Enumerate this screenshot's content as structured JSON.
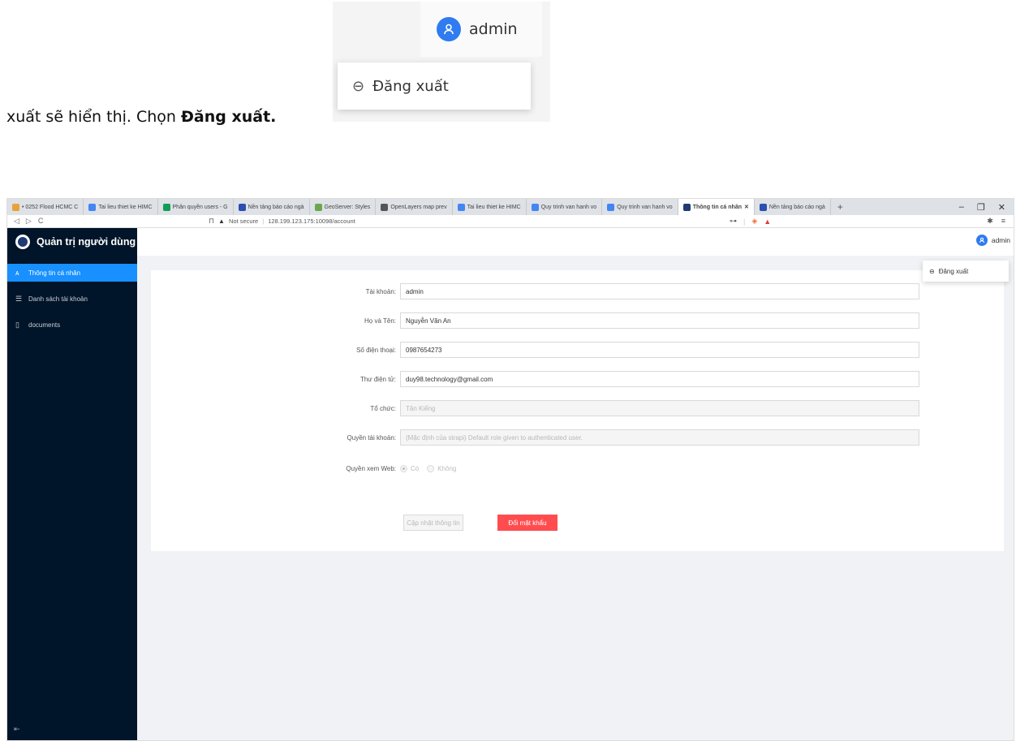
{
  "doc": {
    "text_prefix": "xuất sẽ hiển thị. Chọn ",
    "text_bold": "Đăng xuất."
  },
  "inset": {
    "username": "admin",
    "logout_label": "Đăng xuất",
    "logout_icon": "logout-icon"
  },
  "browser": {
    "tabs": [
      {
        "label": "• 0252 Flood HCMC C",
        "color": "#e8a23a"
      },
      {
        "label": "Tai lieu thiet ke HIMC",
        "color": "#4285f4"
      },
      {
        "label": "Phân quyền users - G",
        "color": "#0f9d58"
      },
      {
        "label": "Nền tảng báo cáo ngà",
        "color": "#2a4fb0"
      },
      {
        "label": "GeoServer: Styles",
        "color": "#6aa84f"
      },
      {
        "label": "OpenLayers map prev",
        "color": "#555555"
      },
      {
        "label": "Tai lieu thiet ke HIMC",
        "color": "#4285f4"
      },
      {
        "label": "Quy trinh van hanh vo",
        "color": "#4285f4"
      },
      {
        "label": "Quy trinh van hanh vo",
        "color": "#4285f4"
      },
      {
        "label": "Thông tin cá nhân",
        "color": "#1f3b73",
        "active": true
      },
      {
        "label": "Nền tảng báo cáo ngà",
        "color": "#2a4fb0"
      }
    ],
    "security": "Not secure",
    "url": "128.199.123.175:10098/account"
  },
  "app": {
    "title": "Quản trị người dùng",
    "menu": [
      {
        "label": "Thông tin cá nhân",
        "icon": "user-icon"
      },
      {
        "label": "Danh sách tài khoản",
        "icon": "list-icon"
      },
      {
        "label": "documents",
        "icon": "file-icon"
      }
    ],
    "header_user": "admin",
    "dropdown_logout": "Đăng xuất"
  },
  "form": {
    "account_label": "Tài khoản:",
    "account_value": "admin",
    "name_label": "Họ và Tên:",
    "name_value": "Nguyễn Văn An",
    "phone_label": "Số điện thoại:",
    "phone_value": "0987654273",
    "email_label": "Thư điện tử:",
    "email_value": "duy98.technology@gmail.com",
    "org_label": "Tổ chức:",
    "org_value": "Tân Kiểng",
    "role_label": "Quyền tài khoản:",
    "role_value": "(Mặc định của strapi) Default role given to authenticated user.",
    "web_label": "Quyền xem Web:",
    "web_yes": "Có",
    "web_no": "Không",
    "update_button": "Cập nhật thông tin",
    "password_button": "Đổi mật khẩu"
  },
  "colors": {
    "sider": "#001529",
    "accent": "#1890ff",
    "danger": "#ff4d4f"
  }
}
